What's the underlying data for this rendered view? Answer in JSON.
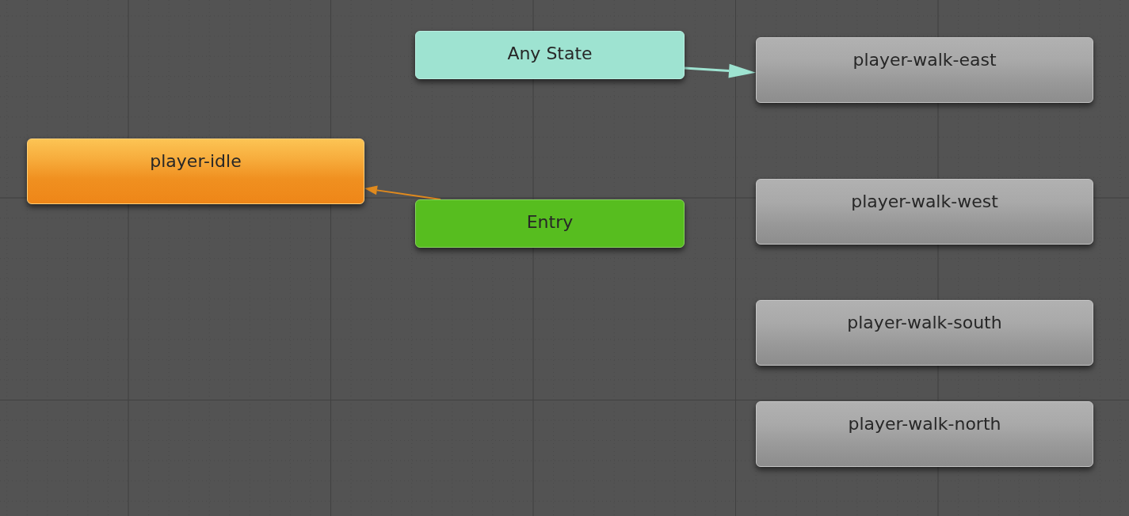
{
  "nodes": [
    {
      "kind": "any_state",
      "label": "Any State"
    },
    {
      "kind": "state",
      "label": "player-walk-east",
      "default": false
    },
    {
      "kind": "state",
      "label": "player-idle",
      "default": true
    },
    {
      "kind": "state",
      "label": "player-walk-west",
      "default": false
    },
    {
      "kind": "entry",
      "label": "Entry"
    },
    {
      "kind": "state",
      "label": "player-walk-south",
      "default": false
    },
    {
      "kind": "state",
      "label": "player-walk-north",
      "default": false
    }
  ]
}
